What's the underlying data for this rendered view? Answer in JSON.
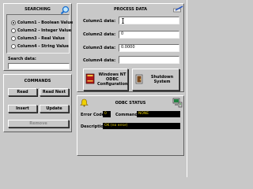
{
  "searching": {
    "title": "SEARCHING",
    "options": [
      {
        "label": "Column1 - Boolean Value",
        "selected": true
      },
      {
        "label": "Column2 - Integer Value",
        "selected": false
      },
      {
        "label": "Column3 - Real Value",
        "selected": false
      },
      {
        "label": "Column4 - String Value",
        "selected": false
      }
    ],
    "search_label": "Search data:",
    "search_value": ""
  },
  "process": {
    "title": "PROCESS DATA",
    "fields": [
      {
        "label": "Column1 data:",
        "value": ""
      },
      {
        "label": "Column2 data:",
        "value": "0"
      },
      {
        "label": "Column3 data:",
        "value": "0.0000"
      },
      {
        "label": "Column4 data:",
        "value": ""
      }
    ],
    "odbc_button": "Windows NT ODBC Configuration",
    "shutdown_button": "Shutdown System"
  },
  "commands": {
    "title": "COMMANDS",
    "read": "Read",
    "read_next": "Read Next",
    "insert": "Insert",
    "update": "Update",
    "remove": "Remove"
  },
  "odbc_status": {
    "title": "ODBC STATUS",
    "error_code_label": "Error Code",
    "error_code_value": "0",
    "command_label": "Command",
    "command_value": "NONE",
    "description_label": "Description",
    "description_value": "OK (no error)"
  },
  "colors": {
    "background": "#c8c8c8",
    "status_field_bg": "#000000",
    "status_field_text": "#e8d000"
  }
}
